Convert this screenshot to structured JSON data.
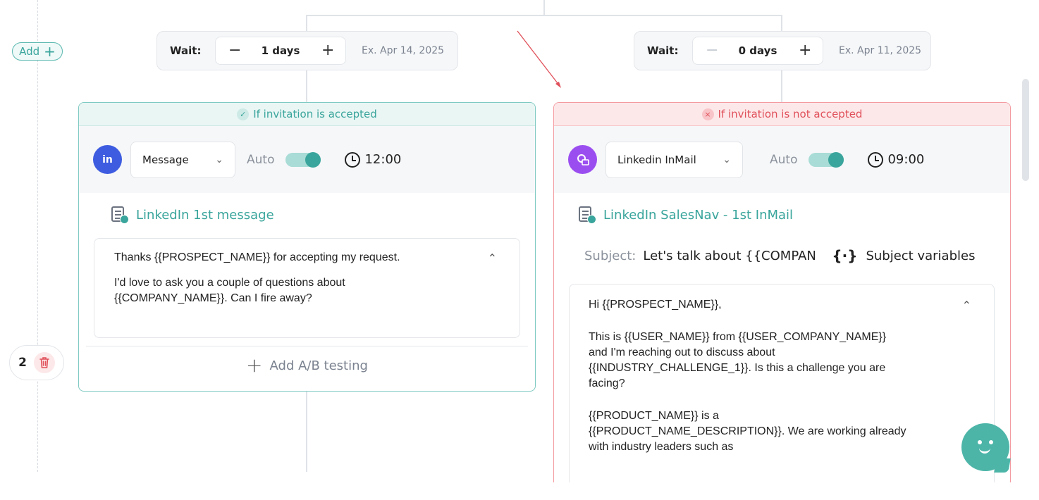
{
  "left_rail": {
    "add_label": "Add",
    "step_number": "2"
  },
  "wait_left": {
    "label": "Wait:",
    "minus": "−",
    "value": "1 days",
    "plus": "+",
    "example": "Ex. Apr 14, 2025"
  },
  "wait_right": {
    "label": "Wait:",
    "minus": "−",
    "value": "0 days",
    "plus": "+",
    "example": "Ex. Apr 11, 2025"
  },
  "accepted_card": {
    "header": "If invitation is accepted",
    "header_icon": "✓",
    "channel_icon": "in",
    "action": "Message",
    "auto_label": "Auto",
    "auto_enabled": true,
    "time": "12:00",
    "template_title": "LinkedIn 1st message",
    "message_line1": "Thanks {{PROSPECT_NAME}} for accepting my request.",
    "message_line2": "I'd love to ask you a couple of questions about\n{{COMPANY_NAME}}. Can I fire away?",
    "ab_testing": "Add A/B testing"
  },
  "not_accepted_card": {
    "header": "If invitation is not accepted",
    "header_icon": "×",
    "action": "Linkedin InMail",
    "auto_label": "Auto",
    "auto_enabled": true,
    "time": "09:00",
    "template_title": "LinkedIn SalesNav - 1st InMail",
    "subject_label": "Subject:",
    "subject_value": "Let's talk about {{COMPAN",
    "subject_vars_icon": "{·}",
    "subject_vars_label": "Subject variables",
    "greeting": "Hi {{PROSPECT_NAME}},",
    "para1": "This is {{USER_NAME}} from {{USER_COMPANY_NAME}}\nand I'm reaching out to discuss about\n{{INDUSTRY_CHALLENGE_1}}. Is this a challenge you are\nfacing?",
    "para2": "{{PRODUCT_NAME}} is a\n{{PRODUCT_NAME_DESCRIPTION}}. We are working already\nwith industry leaders such as"
  },
  "colors": {
    "accent_teal": "#3aa59c",
    "danger_red": "#e0505a",
    "linkedin_blue": "#3d5ce0",
    "inmail_purple": "#9b4ef0"
  }
}
